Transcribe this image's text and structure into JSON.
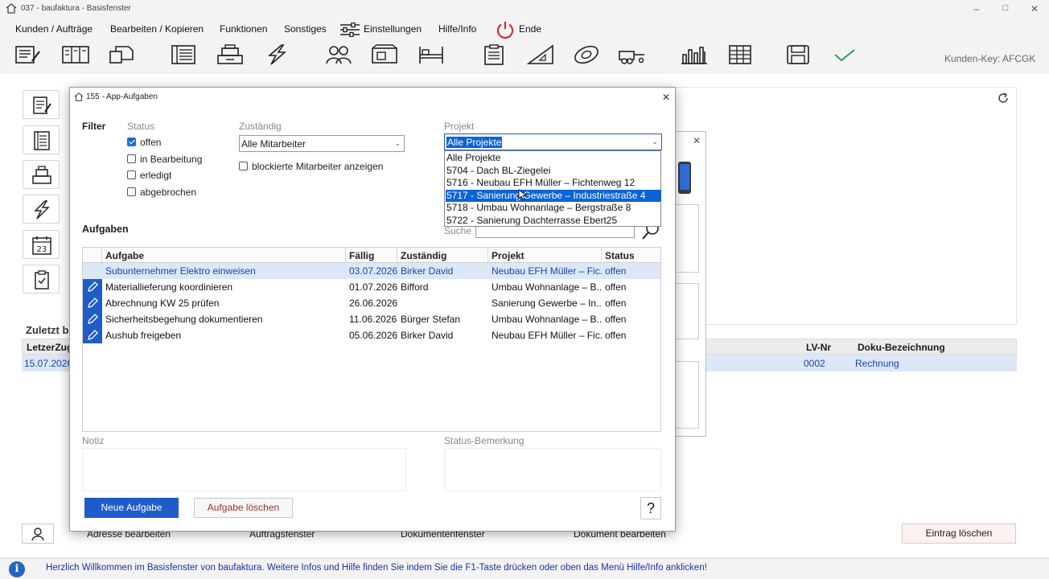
{
  "window": {
    "title": "037  -  baufaktura  -  Basisfenster"
  },
  "menu": [
    "Kunden / Aufträge",
    "Bearbeiten / Kopieren",
    "Funktionen",
    "Sonstiges",
    "Einstellungen",
    "Hilfe/Info",
    "Ende"
  ],
  "toolbar": {
    "icons": [
      "document-edit-icon",
      "columns-icon",
      "copy-pages-icon",
      "list-document-icon",
      "cash-register-icon",
      "lightning-icon",
      "users-icon",
      "truck-box-icon",
      "bed-icon",
      "clipboard-icon",
      "ruler-triangle-icon",
      "tape-measure-icon",
      "trailer-icon",
      "crane-icon",
      "table-grid-icon",
      "save-icon",
      "checkmark-icon"
    ],
    "kunden_key": "Kunden-Key: AFCGK"
  },
  "background": {
    "zuletzt_label": "Zuletzt b",
    "table_headers": [
      "LetzerZug",
      "LV-Nr",
      "Doku-Bezeichnung"
    ],
    "row": {
      "date": "15.07.2026",
      "lv_nr": "0002",
      "doku": "Rechnung"
    },
    "buttons": [
      "Adresse bearbeiten",
      "Auftragsfenster",
      "Dokumentenfenster",
      "Dokument bearbeiten",
      "Eintrag löschen"
    ]
  },
  "dialog": {
    "title": "155  -  App-Aufgaben",
    "filter_label": "Filter",
    "status_label": "Status",
    "status_options": [
      {
        "label": "offen",
        "checked": true
      },
      {
        "label": "in Bearbeitung",
        "checked": false
      },
      {
        "label": "erledigt",
        "checked": false
      },
      {
        "label": "abgebrochen",
        "checked": false
      }
    ],
    "zustaendig_label": "Zuständig",
    "zustaendig_value": "Alle Mitarbeiter",
    "blocked_label": "blockierte Mitarbeiter anzeigen",
    "projekt_label": "Projekt",
    "projekt_value": "Alle Projekte",
    "projekt_options": [
      "Alle Projekte",
      "5704 - Dach BL-Ziegelei",
      "5716 - Neubau EFH Müller – Fichtenweg 12",
      "5717 - Sanierung Gewerbe – Industriestraße 4",
      "5718 - Umbau Wohnanlage – Bergstraße 8",
      "5722 - Sanierung Dachterrasse Ebert25"
    ],
    "projekt_selected_index": 3,
    "aufgaben_label": "Aufgaben",
    "suche_label": "Suche",
    "table_headers": [
      "Aufgabe",
      "Fällig",
      "Zuständig",
      "Projekt",
      "Status"
    ],
    "rows": [
      {
        "aufgabe": "Subunternehmer Elektro einweisen",
        "faellig": "03.07.2026",
        "zustaendig": "Birker David",
        "projekt": "Neubau EFH Müller – Fic...",
        "status": "offen"
      },
      {
        "aufgabe": "Materiallieferung koordinieren",
        "faellig": "01.07.2026",
        "zustaendig": "Bifford",
        "projekt": "Umbau Wohnanlage – B...",
        "status": "offen"
      },
      {
        "aufgabe": "Abrechnung KW 25 prüfen",
        "faellig": "26.06.2026",
        "zustaendig": "",
        "projekt": "Sanierung Gewerbe – In...",
        "status": "offen"
      },
      {
        "aufgabe": "Sicherheitsbegehung dokumentieren",
        "faellig": "11.06.2026",
        "zustaendig": "Bürger Stefan",
        "projekt": "Umbau Wohnanlage – B...",
        "status": "offen"
      },
      {
        "aufgabe": "Aushub freigeben",
        "faellig": "05.06.2026",
        "zustaendig": "Birker David",
        "projekt": "Neubau EFH Müller – Fic...",
        "status": "offen"
      }
    ],
    "notiz_label": "Notiz",
    "status_bemerkung_label": "Status-Bemerkung",
    "neue_aufgabe": "Neue Aufgabe",
    "aufgabe_loeschen": "Aufgabe löschen",
    "help": "?"
  },
  "statusbar": {
    "text": "Herzlich Willkommen im Basisfenster von baufaktura. Weitere Infos und Hilfe finden Sie indem Sie die F1-Taste drücken oder oben das Menü Hilfe/Info anklicken!",
    "info": "i"
  },
  "colors": {
    "accent": "#1e5cc8",
    "selection": "#0a64d8",
    "status_text": "#1e2fb0"
  }
}
